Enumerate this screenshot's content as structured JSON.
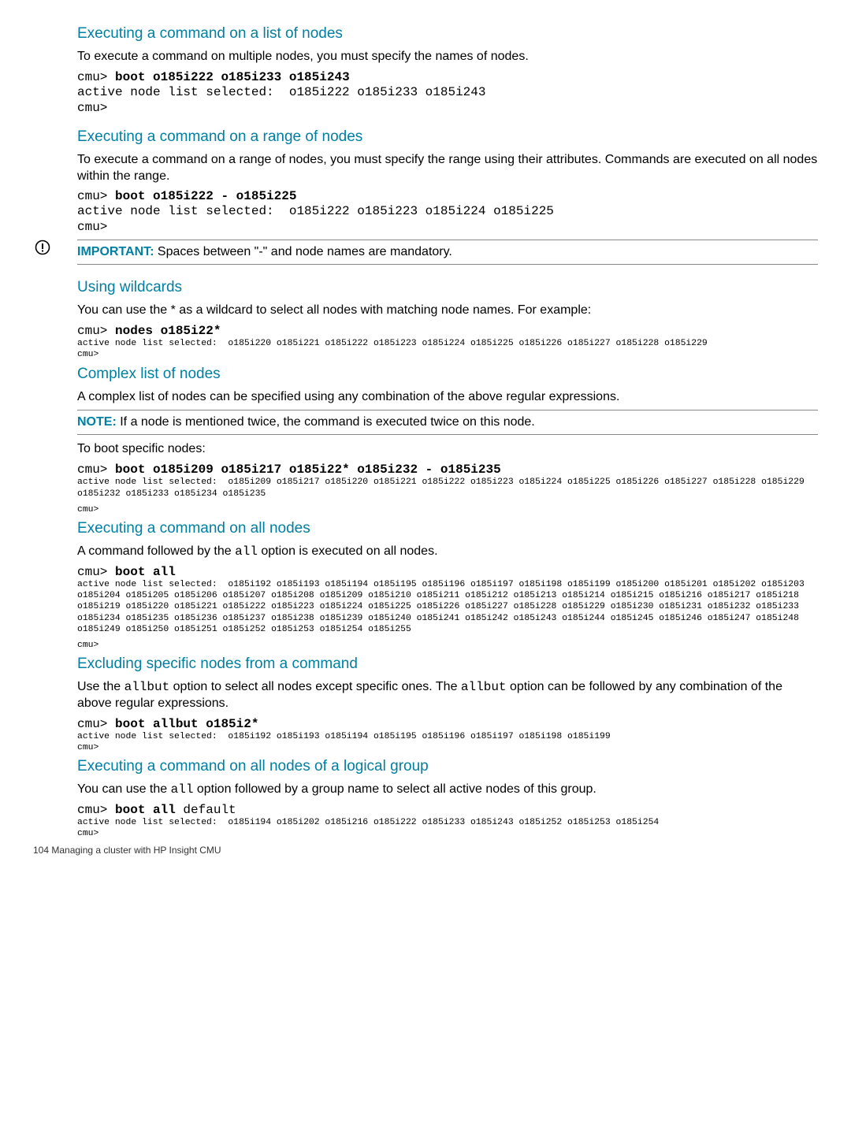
{
  "s1": {
    "title": "Executing a command on a list of nodes",
    "desc": "To execute a command on multiple nodes, you must specify the names of nodes.",
    "prompt": "cmu> ",
    "cmd": "boot o185i222 o185i233 o185i243",
    "out": "active node list selected:  o185i222 o185i233 o185i243\ncmu>"
  },
  "s2": {
    "title": "Executing a command on a range of nodes",
    "desc": "To execute a command on a range of nodes, you must specify the range using their attributes. Commands are executed on all nodes within the range.",
    "prompt": "cmu> ",
    "cmd": "boot o185i222 - o185i225",
    "out": "active node list selected:  o185i222 o185i223 o185i224 o185i225\ncmu>"
  },
  "important": {
    "label": "IMPORTANT:",
    "text": "   Spaces between \"-\" and node names are mandatory."
  },
  "s3": {
    "title": "Using wildcards",
    "desc": "You can use the * as a wildcard to select all nodes with matching node names. For example:",
    "prompt": "cmu> ",
    "cmd": "nodes o185i22*",
    "out": "active node list selected:  o185i220 o185i221 o185i222 o185i223 o185i224 o185i225 o185i226 o185i227 o185i228 o185i229\ncmu>"
  },
  "s4": {
    "title": "Complex list of nodes",
    "desc": "A complex list of nodes can be specified using any combination of the above regular expressions.",
    "note_label": "NOTE:",
    "note_text": "   If a node is mentioned twice, the command is executed twice on this node.",
    "desc2": "To boot specific nodes:",
    "prompt": "cmu> ",
    "cmd": "boot o185i209 o185i217 o185i22* o185i232 - o185i235",
    "out": "active node list selected:  o185i209 o185i217 o185i220 o185i221 o185i222 o185i223 o185i224 o185i225 o185i226 o185i227 o185i228 o185i229 o185i232 o185i233 o185i234 o185i235",
    "out2": "cmu>"
  },
  "s5": {
    "title": "Executing a command on all nodes",
    "desc_a": "A command followed by the ",
    "desc_code": "all",
    "desc_b": " option is executed on all nodes.",
    "prompt": "cmu> ",
    "cmd": "boot all",
    "out": "active node list selected:  o185i192 o185i193 o185i194 o185i195 o185i196 o185i197 o185i198 o185i199 o185i200 o185i201 o185i202 o185i203 o185i204 o185i205 o185i206 o185i207 o185i208 o185i209 o185i210 o185i211 o185i212 o185i213 o185i214 o185i215 o185i216 o185i217 o185i218 o185i219 o185i220 o185i221 o185i222 o185i223 o185i224 o185i225 o185i226 o185i227 o185i228 o185i229 o185i230 o185i231 o185i232 o185i233 o185i234 o185i235 o185i236 o185i237 o185i238 o185i239 o185i240 o185i241 o185i242 o185i243 o185i244 o185i245 o185i246 o185i247 o185i248 o185i249 o185i250 o185i251 o185i252 o185i253 o185i254 o185i255",
    "out2": "cmu>"
  },
  "s6": {
    "title": "Excluding specific nodes from a command",
    "desc_a": "Use the ",
    "desc_code1": "allbut",
    "desc_b": " option to select all nodes except specific ones. The ",
    "desc_code2": "allbut",
    "desc_c": " option can be followed by any combination of the above regular expressions.",
    "prompt": "cmu> ",
    "cmd": "boot allbut o185i2*",
    "out": "active node list selected:  o185i192 o185i193 o185i194 o185i195 o185i196 o185i197 o185i198 o185i199\ncmu>"
  },
  "s7": {
    "title": "Executing a command on all nodes of a logical group",
    "desc_a": "You can use the ",
    "desc_code": "all",
    "desc_b": " option followed by a group name to select all active nodes of this group.",
    "prompt": "cmu> ",
    "cmd": "boot all",
    "arg": " default",
    "out": "active node list selected:  o185i194 o185i202 o185i216 o185i222 o185i233 o185i243 o185i252 o185i253 o185i254\ncmu>"
  },
  "footer": {
    "page": "104",
    "title": "   Managing a cluster with HP Insight CMU"
  }
}
